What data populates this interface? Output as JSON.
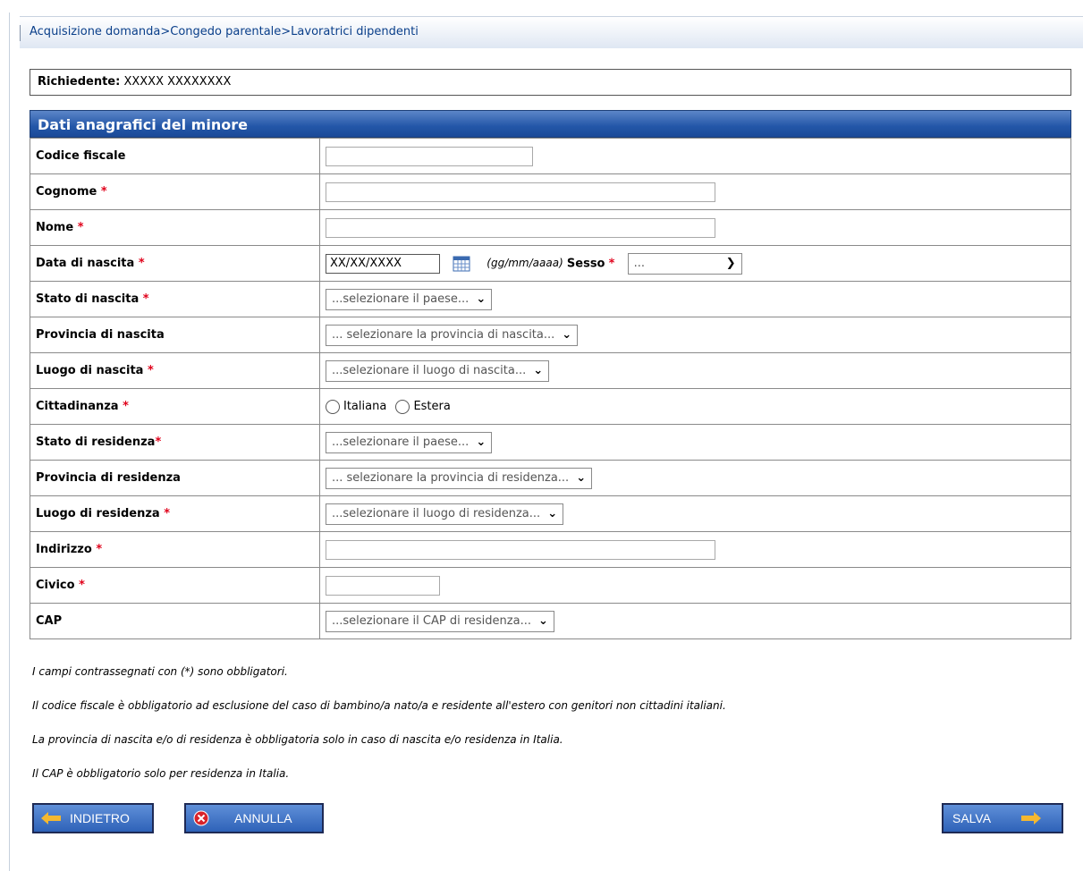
{
  "breadcrumb": "Acquisizione domanda>Congedo parentale>Lavoratrici dipendenti",
  "requester": {
    "label": "Richiedente:",
    "value": "XXXXX XXXXXXXX"
  },
  "section_title": "Dati anagrafici del minore",
  "required_marker": "*",
  "fields": {
    "codice_fiscale": {
      "label": "Codice fiscale",
      "value": ""
    },
    "cognome": {
      "label": "Cognome",
      "value": ""
    },
    "nome": {
      "label": "Nome",
      "value": ""
    },
    "data_nascita": {
      "label": "Data di nascita",
      "value": "XX/XX/XXXX",
      "format_hint": "(gg/mm/aaaa)",
      "sex_label": "Sesso",
      "sex_value": "..."
    },
    "stato_nascita": {
      "label": "Stato di nascita",
      "value": "...selezionare il paese..."
    },
    "provincia_nascita": {
      "label": "Provincia di nascita",
      "value": "... selezionare la provincia di nascita..."
    },
    "luogo_nascita": {
      "label": "Luogo di nascita",
      "value": "...selezionare il luogo di nascita..."
    },
    "cittadinanza": {
      "label": "Cittadinanza",
      "options": [
        "Italiana",
        "Estera"
      ]
    },
    "stato_residenza": {
      "label": "Stato di residenza",
      "value": "...selezionare il paese..."
    },
    "provincia_residenza": {
      "label": "Provincia di residenza",
      "value": "... selezionare la provincia di residenza..."
    },
    "luogo_residenza": {
      "label": "Luogo di residenza",
      "value": "...selezionare il luogo di residenza..."
    },
    "indirizzo": {
      "label": "Indirizzo",
      "value": ""
    },
    "civico": {
      "label": "Civico",
      "value": ""
    },
    "cap": {
      "label": "CAP",
      "value": "...selezionare il CAP di residenza..."
    }
  },
  "notes": [
    "I campi contrassegnati con (*) sono obbligatori.",
    "Il codice fiscale è obbligatorio ad esclusione del caso di bambino/a nato/a e residente all'estero con genitori non cittadini italiani.",
    "La provincia di nascita e/o di residenza è obbligatoria solo in caso di nascita e/o residenza in Italia.",
    "Il CAP è obbligatorio solo per residenza in Italia."
  ],
  "buttons": {
    "back": "INDIETRO",
    "cancel": "ANNULLA",
    "save": "SALVA"
  },
  "colors": {
    "header_blue": "#2356a8",
    "required_red": "#e0001a",
    "breadcrumb_text": "#0a3f8a",
    "button_blue": "#2e62b8"
  },
  "icons": {
    "calendar": "calendar-icon",
    "back": "arrow-left-icon",
    "cancel": "cancel-x-icon",
    "save": "arrow-right-icon"
  }
}
